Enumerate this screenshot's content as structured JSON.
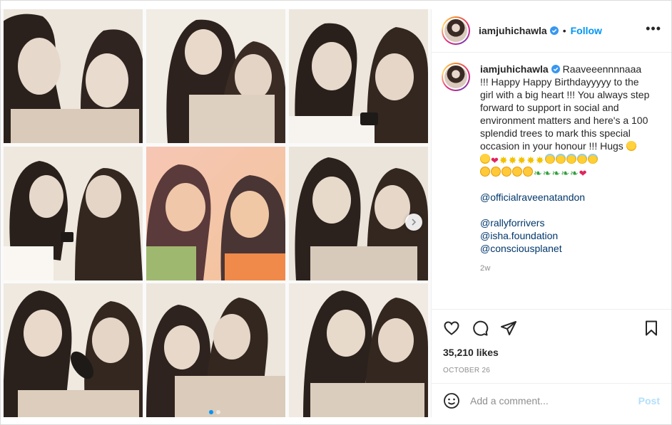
{
  "post": {
    "username": "iamjuhichawla",
    "separator": "•",
    "follow_label": "Follow",
    "more_label": "•••",
    "caption": "Raaveeennnnaaa !!! Happy Happy Birthdayyyyy to the girl with a big heart !!! You always step forward to support in social and environment matters and here's a 100 splendid trees to mark this special occasion in your honour !!! Hugs",
    "mentions": [
      "@officialraveenatandon",
      "@rallyforrivers",
      "@isha.foundation",
      "@consciousplanet"
    ],
    "time_ago": "2w",
    "likes": "35,210 likes",
    "date": "OCTOBER 26"
  },
  "comments": [
    {
      "username": "officialraveenatandon"
    }
  ],
  "comment_box": {
    "placeholder": "Add a comment...",
    "post_label": "Post"
  },
  "media": {
    "slides_total": 2,
    "active_slide": 1
  },
  "colors": {
    "link_blue": "#0095f6",
    "mention_blue": "#00376b",
    "text": "#262626",
    "muted": "#8e8e8e",
    "post_disabled": "#b2dffc"
  },
  "icons": [
    "verified-badge-icon",
    "heart-icon",
    "comment-icon",
    "share-icon",
    "bookmark-icon",
    "emoji-icon",
    "chevron-right-icon",
    "more-icon"
  ]
}
